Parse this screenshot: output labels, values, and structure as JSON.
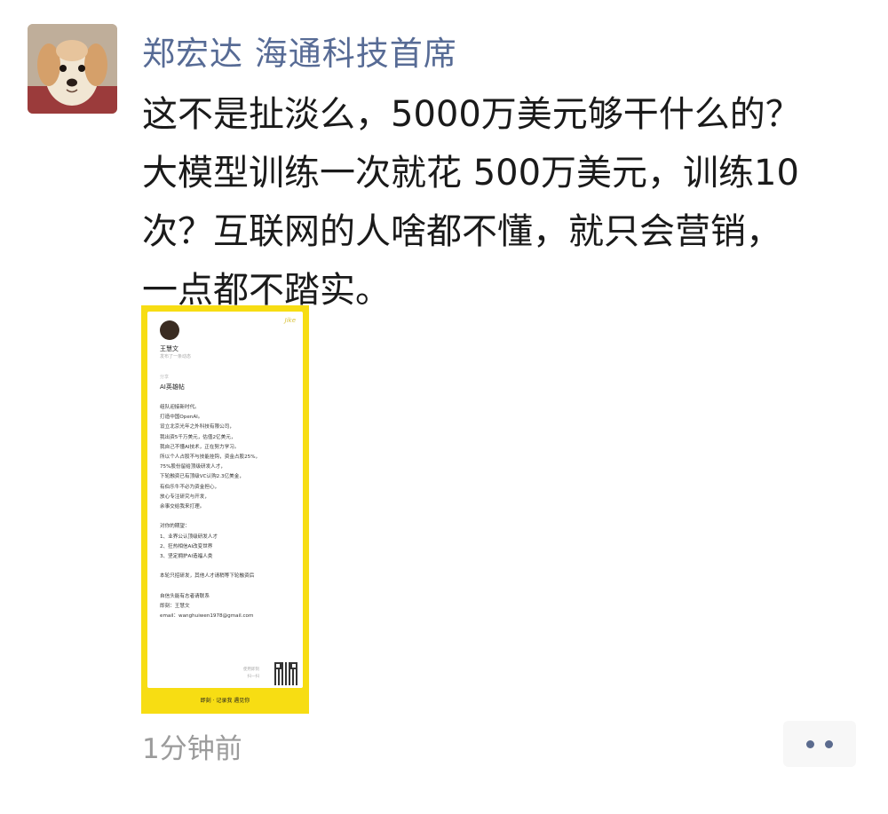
{
  "post": {
    "author": "郑宏达 海通科技首席",
    "text_lines": [
      "这不是扯淡么，5000万美元够干什么的？",
      "大模型训练一次就花 500万美元，训练10",
      "次？互联网的人啥都不懂，就只会营销，",
      "一点都不踏实。"
    ],
    "timestamp": "1分钟前"
  },
  "avatar": {
    "icon": "dog-avatar-icon"
  },
  "attachment": {
    "logo": "Jike",
    "author_name": "王慧文",
    "author_sub": "发布了一条动态",
    "tag": "分享",
    "headline": "AI英雄帖",
    "body_lines": [
      "组队迎接新时代。",
      "打造中国OpenAI。",
      "设立北京光年之外科技有限公司，",
      "我出资5千万美元，估值2亿美元，",
      "我自己不懂AI技术，正在努力学习。",
      "所以个人占股不与技能挂钩，资金占股25%，",
      "75%股份留给顶级研发人才，",
      "下轮融资已有顶级VC认购2.3亿美金，",
      "有伯乐牛不必为资金担心，",
      "放心专注研究与开发，",
      "余事交给我来打理。",
      "",
      "对你的期望：",
      "1、业界公认顶级研发人才",
      "2、狂热相信AI改变世界",
      "3、坚定拥护AI造福人类",
      "",
      "本轮只招研发，其他人才请稍等下轮融资后",
      "",
      "自信头能有志者请联系",
      "即刻：王慧文",
      "email：wanghuiwen1978@gmail.com"
    ],
    "footer_lines": [
      "使用即刻",
      "扫一扫"
    ],
    "banner": "即刻 · 记录我 遇见你",
    "qr_icon": "qr-code-icon"
  },
  "colors": {
    "author": "#576b95",
    "attachment_frame": "#f7dd13",
    "timestamp": "#9b9b9b"
  }
}
